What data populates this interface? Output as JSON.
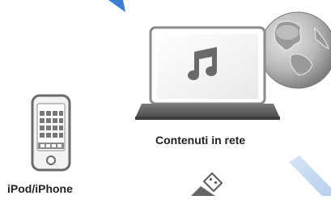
{
  "labels": {
    "network_content": "Contenuti in rete",
    "ipod": "iPod/iPhone"
  },
  "icons": {
    "globe": "globe-icon",
    "laptop": "laptop-icon",
    "music_note": "music-note-icon",
    "ipod": "ipod-iphone-icon",
    "usb": "usb-stick-icon"
  },
  "colors": {
    "icon_grey": "#8a8a8a",
    "icon_dark": "#666666",
    "arrow_blue": "#3d7fd6",
    "arrow_light_blue": "#c7dcf3"
  }
}
